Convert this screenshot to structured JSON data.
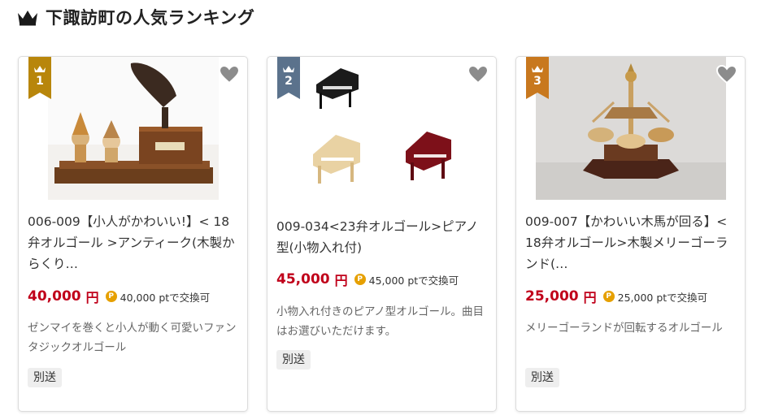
{
  "header": {
    "title": "下諏訪町の人気ランキング",
    "icon": "crown-icon"
  },
  "colors": {
    "rank1": "#b8860b",
    "rank2": "#5b728c",
    "rank3": "#c8781e",
    "price": "#c0001a",
    "point": "#e6a000"
  },
  "items": [
    {
      "rank": "1",
      "title": "006-009【小人がかわいい!】< 18弁オルゴール >アンティーク(木製からくり…",
      "price": "40,000",
      "yen": "円",
      "point_icon": "P",
      "points": "40,000 ptで交換可",
      "description": "ゼンマイを巻くと小人が動く可愛いファンタジックオルゴール",
      "shipping": "別送"
    },
    {
      "rank": "2",
      "title": "009-034<23弁オルゴール>ピアノ型(小物入れ付)",
      "price": "45,000",
      "yen": "円",
      "point_icon": "P",
      "points": "45,000 ptで交換可",
      "description": "小物入れ付きのピアノ型オルゴール。曲目はお選びいただけます。",
      "shipping": "別送"
    },
    {
      "rank": "3",
      "title": "009-007【かわいい木馬が回る】< 18弁オルゴール>木製メリーゴーランド(…",
      "price": "25,000",
      "yen": "円",
      "point_icon": "P",
      "points": "25,000 ptで交換可",
      "description": "メリーゴーランドが回転するオルゴール",
      "shipping": "別送"
    }
  ]
}
